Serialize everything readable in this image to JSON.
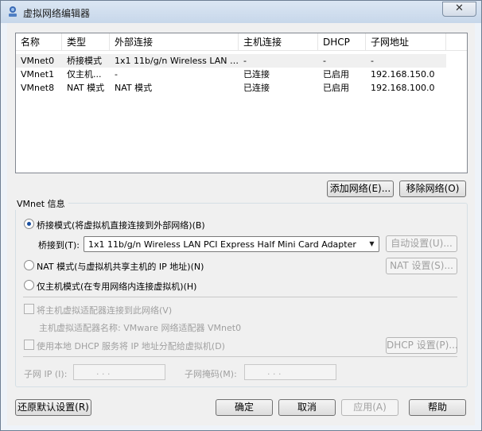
{
  "window": {
    "title": "虚拟网络编辑器",
    "close_glyph": "✕"
  },
  "table": {
    "columns": [
      "名称",
      "类型",
      "外部连接",
      "主机连接",
      "DHCP",
      "子网地址"
    ],
    "rows": [
      [
        "VMnet0",
        "桥接模式",
        "1x1 11b/g/n Wireless LAN P...",
        "-",
        "-",
        "-"
      ],
      [
        "VMnet1",
        "仅主机...",
        "-",
        "已连接",
        "已启用",
        "192.168.150.0"
      ],
      [
        "VMnet8",
        "NAT 模式",
        "NAT 模式",
        "已连接",
        "已启用",
        "192.168.100.0"
      ]
    ]
  },
  "buttons": {
    "add_network": "添加网络(E)...",
    "remove_network": "移除网络(O)",
    "auto_settings": "自动设置(U)...",
    "nat_settings": "NAT 设置(S)...",
    "dhcp_settings": "DHCP 设置(P)...",
    "restore_defaults": "还原默认设置(R)",
    "ok": "确定",
    "cancel": "取消",
    "apply": "应用(A)",
    "help": "帮助"
  },
  "vmnet_info": {
    "group_label": "VMnet 信息",
    "bridged_option": "桥接模式(将虚拟机直接连接到外部网络)(B)",
    "bridged_to_label": "桥接到(T):",
    "bridged_to_value": "1x1 11b/g/n Wireless LAN PCI Express Half Mini Card Adapter",
    "nat_option": "NAT 模式(与虚拟机共享主机的 IP 地址)(N)",
    "hostonly_option": "仅主机模式(在专用网络内连接虚拟机)(H)",
    "connect_host_adapter": "将主机虚拟适配器连接到此网络(V)",
    "host_adapter_name": "主机虚拟适配器名称: VMware 网络适配器 VMnet0",
    "use_dhcp": "使用本地 DHCP 服务将 IP 地址分配给虚拟机(D)",
    "subnet_ip_label": "子网 IP (I):",
    "subnet_ip_value": ".     .     .",
    "subnet_mask_label": "子网掩码(M):",
    "subnet_mask_value": ".     .     ."
  },
  "colors": {
    "radio_dot": "#1a4fa0",
    "disabled_text": "#a0a0a0"
  }
}
